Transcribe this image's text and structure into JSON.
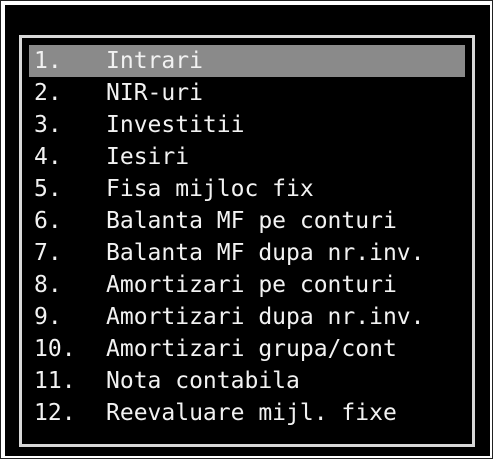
{
  "menu": {
    "selected_index": 0,
    "items": [
      {
        "number": "1.",
        "label": "Intrari"
      },
      {
        "number": "2.",
        "label": "NIR-uri"
      },
      {
        "number": "3.",
        "label": "Investitii"
      },
      {
        "number": "4.",
        "label": "Iesiri"
      },
      {
        "number": "5.",
        "label": "Fisa mijloc fix"
      },
      {
        "number": "6.",
        "label": "Balanta MF pe conturi"
      },
      {
        "number": "7.",
        "label": "Balanta MF dupa nr.inv."
      },
      {
        "number": "8.",
        "label": "Amortizari pe conturi"
      },
      {
        "number": "9.",
        "label": "Amortizari dupa nr.inv."
      },
      {
        "number": "10.",
        "label": "Amortizari grupa/cont"
      },
      {
        "number": "11.",
        "label": "Nota contabila"
      },
      {
        "number": "12.",
        "label": "Reevaluare mijl. fixe"
      }
    ]
  },
  "colors": {
    "background": "#000000",
    "text": "#f2f2f2",
    "selection": "#8a8a8a",
    "border": "#d8d8d8"
  }
}
